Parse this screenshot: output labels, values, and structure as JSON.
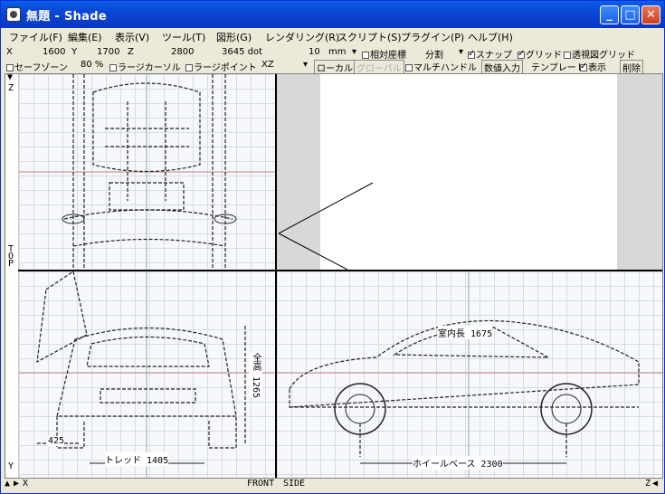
{
  "window": {
    "title": "無題 - Shade"
  },
  "menu": [
    "ファイル(F)",
    "編集(E)",
    "表示(V)",
    "ツール(T)",
    "図形(G)",
    "レンダリング(R)",
    "スクリプト(S)",
    "プラグイン(P)",
    "ヘルプ(H)"
  ],
  "toolbar1": {
    "x_label": "X",
    "x_value": "1600",
    "y_label": "Y",
    "y_value": "1700",
    "z_label": "Z",
    "z_value": "2800",
    "dot_value": "3645 dot",
    "grid_size": "10",
    "grid_unit": "mm",
    "relative_coords": "相対座標",
    "split": "分割",
    "snap": "スナップ",
    "grid": "グリッド",
    "perspective_grid": "透視図グリッド"
  },
  "toolbar2": {
    "safe_zone": "セーフゾーン",
    "zoom": "80 %",
    "large_cursor": "ラージカーソル",
    "large_point": "ラージポイント",
    "plane": "XZ",
    "local": "ローカル",
    "global": "グローバル",
    "multi_handle": "マルチハンドル",
    "numeric_input": "数値入力",
    "template": "テンプレート",
    "show": "表示",
    "delete": "削除"
  },
  "views": {
    "top_axis_z": "Z",
    "top_axis_t": "T",
    "top_axis_o": "O",
    "top_axis_p": "P",
    "front_axis_y": "Y",
    "label_front": "FRONT",
    "label_side": "SIDE",
    "axis_x": "X",
    "axis_z2": "Z"
  },
  "blueprint_labels": {
    "tread": "トレッド 1405",
    "wheelbase": "ホイールベース 2300",
    "height": "全高 1265",
    "front_width": "425",
    "interior": "室内長 1675"
  }
}
